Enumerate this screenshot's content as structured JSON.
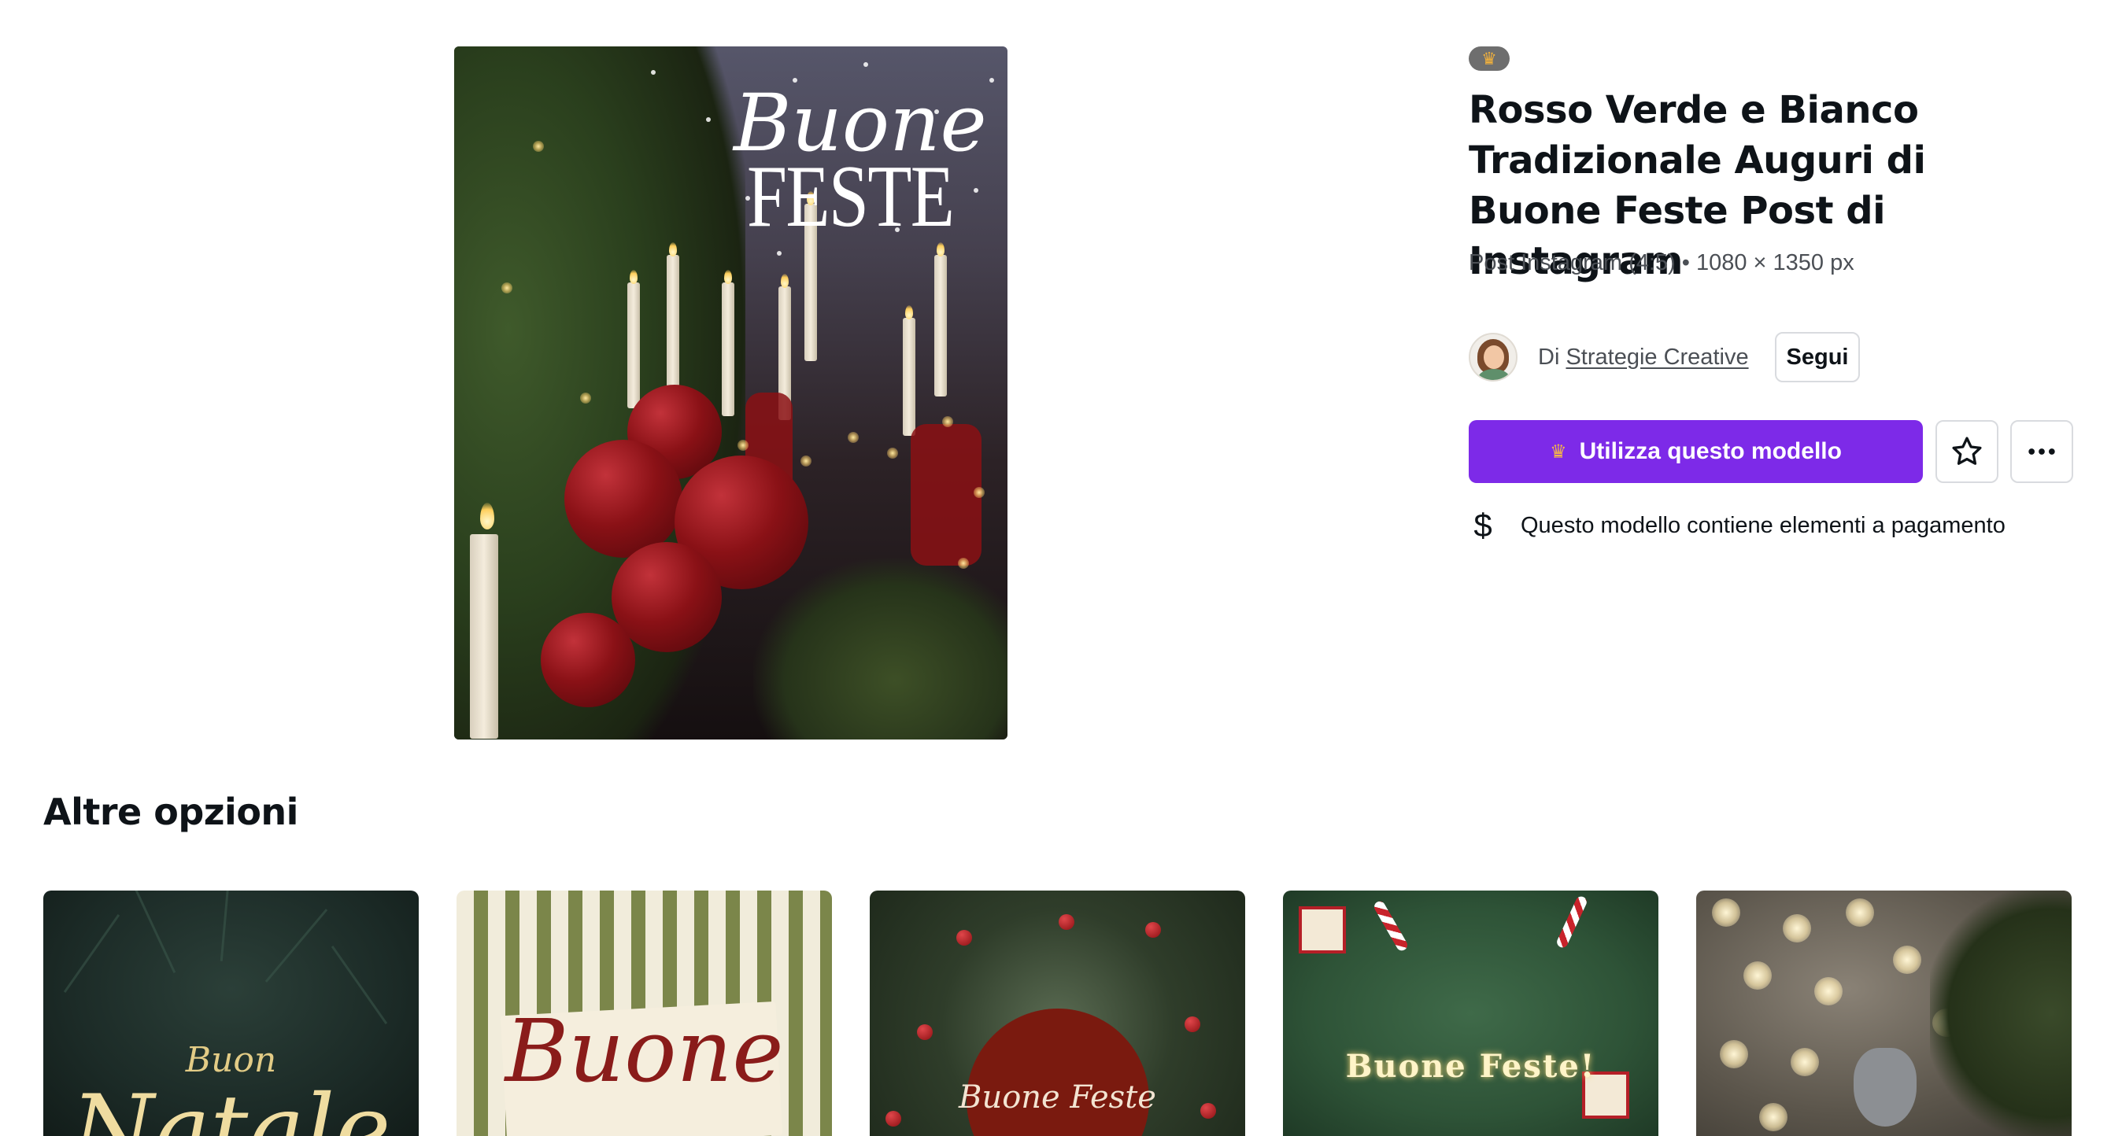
{
  "template": {
    "preview_text_line1": "Buone",
    "preview_text_line2": "FESTE",
    "title": "Rosso Verde e Bianco Tradizionale Auguri di Buone Feste Post di Instagram",
    "subtitle": "Post Instagram (4:5) • 1080 × 1350 px",
    "badge_icon": "crown-icon",
    "author_prefix": "Di",
    "author_name": "Strategie Creative",
    "follow_label": "Segui",
    "use_button_label": "Utilizza questo modello",
    "paid_notice": "Questo modello contiene elementi a pagamento",
    "colors": {
      "primary": "#7d2ae8",
      "crown": "#f3b44a",
      "text": "#0e1318",
      "muted": "#4b4f55",
      "border": "#d9dbdf"
    }
  },
  "more_options": {
    "title": "Altre opzioni",
    "cards": [
      {
        "text1": "Buon",
        "text2": "Natale"
      },
      {
        "text1": "Buone"
      },
      {
        "text1": "Buone Feste"
      },
      {
        "text1": "Buone Feste!"
      },
      {}
    ]
  }
}
